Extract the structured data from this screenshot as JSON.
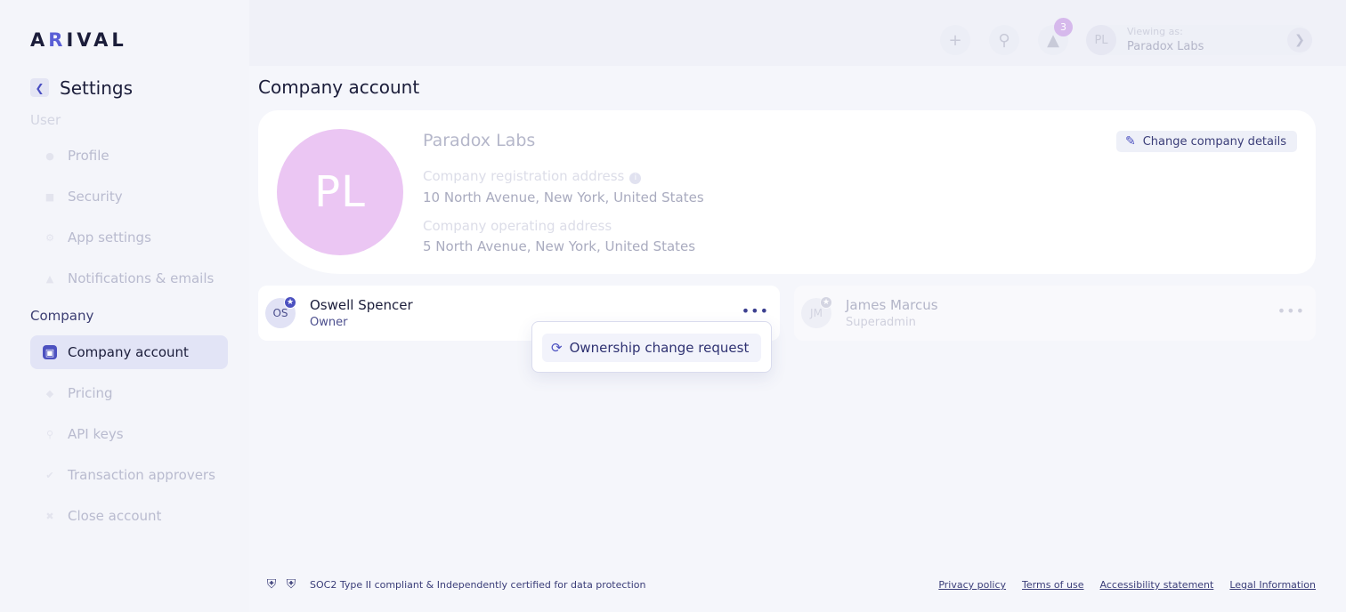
{
  "brand": {
    "logo_pre": "A",
    "logo_accent": "R",
    "logo_post": "IVAL"
  },
  "sidebar": {
    "back_icon": "chevron-left-icon",
    "title": "Settings",
    "user_section_label": "User",
    "user_items": [
      {
        "label": "Profile",
        "icon": "person-icon"
      },
      {
        "label": "Security",
        "icon": "lock-icon"
      },
      {
        "label": "App settings",
        "icon": "gear-icon"
      },
      {
        "label": "Notifications & emails",
        "icon": "bell-icon"
      }
    ],
    "company_section_label": "Company",
    "company_items": [
      {
        "label": "Company account",
        "icon": "briefcase-icon",
        "active": true
      },
      {
        "label": "Pricing",
        "icon": "tag-icon"
      },
      {
        "label": "API keys",
        "icon": "key-icon"
      },
      {
        "label": "Transaction approvers",
        "icon": "badge-check-icon"
      },
      {
        "label": "Close account",
        "icon": "close-circle-icon"
      }
    ]
  },
  "topbar": {
    "notification_count": "3",
    "viewing_label": "Viewing as:",
    "viewing_value": "Paradox Labs",
    "viewing_avatar": "PL"
  },
  "main": {
    "page_title": "Company account",
    "company": {
      "avatar_initials": "PL",
      "avatar_color": "#ebc6f3",
      "name": "Paradox Labs",
      "registration_label": "Company registration address",
      "registration_value": "10 North Avenue, New York, United States",
      "operating_label": "Company operating address",
      "operating_value": "5 North Avenue, New York, United States",
      "change_button": "Change company details"
    },
    "members": [
      {
        "initials": "OS",
        "name": "Oswell Spencer",
        "role": "Owner"
      },
      {
        "initials": "JM",
        "name": "James Marcus",
        "role": "Superadmin"
      }
    ],
    "dropdown": {
      "item_label": "Ownership change request"
    }
  },
  "footer": {
    "compliance_text": "SOC2 Type II compliant & Independently certified for data protection",
    "links": [
      "Privacy policy",
      "Terms of use",
      "Accessibility statement",
      "Legal Information"
    ]
  },
  "colors": {
    "accent": "#4c51c0",
    "text": "#1b1d3a"
  }
}
